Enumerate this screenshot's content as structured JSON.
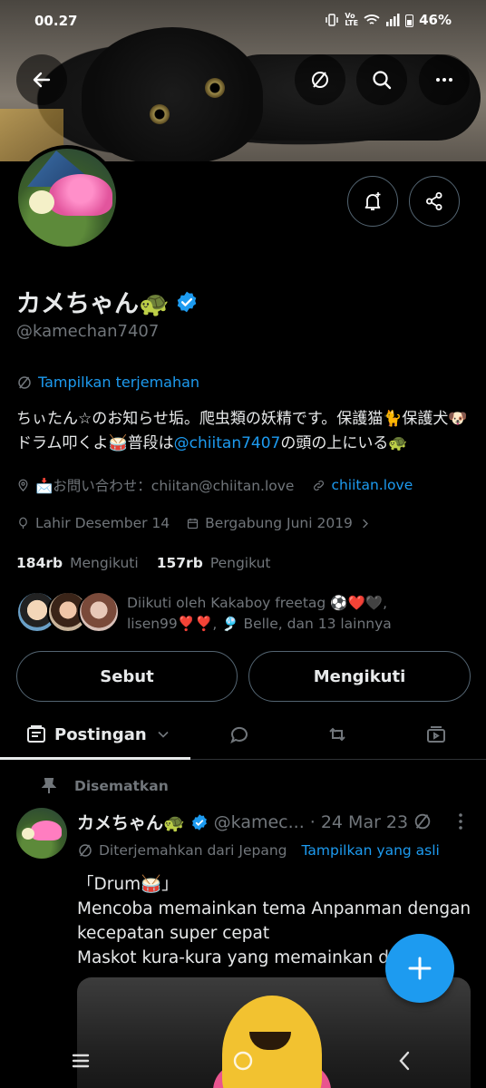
{
  "status_bar": {
    "time": "00.27",
    "battery": "46%",
    "icons": [
      "vibrate-icon",
      "volte-icon",
      "wifi-icon",
      "signal-icon",
      "battery-icon"
    ]
  },
  "header": {
    "back_icon": "arrow-left-icon",
    "translate_icon": "no-translate-icon",
    "search_icon": "search-icon",
    "more_icon": "more-horizontal-icon"
  },
  "profile": {
    "display_name": "カメちゃん🐢",
    "handle": "@kamechan7407",
    "verified": true,
    "translate_label": "Tampilkan terjemahan",
    "bio_parts": {
      "part1": "ちぃたん☆のお知らせ垢。爬虫類の妖精です。保護猫🐈保護犬🐶ドラム叩くよ🥁普段は",
      "link": "@chiitan7407",
      "part2": "の頭の上にいる🐢"
    },
    "contact": "📩お問い合わせ：chiitan@chiitan.love",
    "website": "chiitan.love",
    "birthday": "Lahir Desember 14",
    "joined": "Bergabung Juni 2019",
    "following_count": "184rb",
    "following_label": "Mengikuti",
    "followers_count": "157rb",
    "followers_label": "Pengikut",
    "followed_by": "Diikuti oleh Kakaboy freetag ⚽❤️🖤, lisen99❣️❣️, 🎐 Belle, dan 13 lainnya",
    "mention_button": "Sebut",
    "follow_button": "Mengikuti"
  },
  "tabs": {
    "posts_label": "Postingan",
    "items": [
      "posts-icon",
      "replies-icon",
      "repost-icon",
      "media-icon"
    ]
  },
  "tweet": {
    "pinned_label": "Disematkan",
    "name": "カメちゃん🐢",
    "handle": "@kamec...",
    "date": "· 24 Mar 23",
    "translated_from": "Diterjemahkan dari Jepang",
    "show_original": "Tampilkan yang asli",
    "line1": "「Drum🥁」",
    "line2": "Mencoba memainkan tema Anpanman dengan kecepatan super cepat",
    "line3": "Maskot kura-kura yang memainkan dru"
  },
  "colors": {
    "accent": "#1d9bf0",
    "background": "#000000",
    "text_primary": "#e7e9ea",
    "text_secondary": "#71767b"
  }
}
